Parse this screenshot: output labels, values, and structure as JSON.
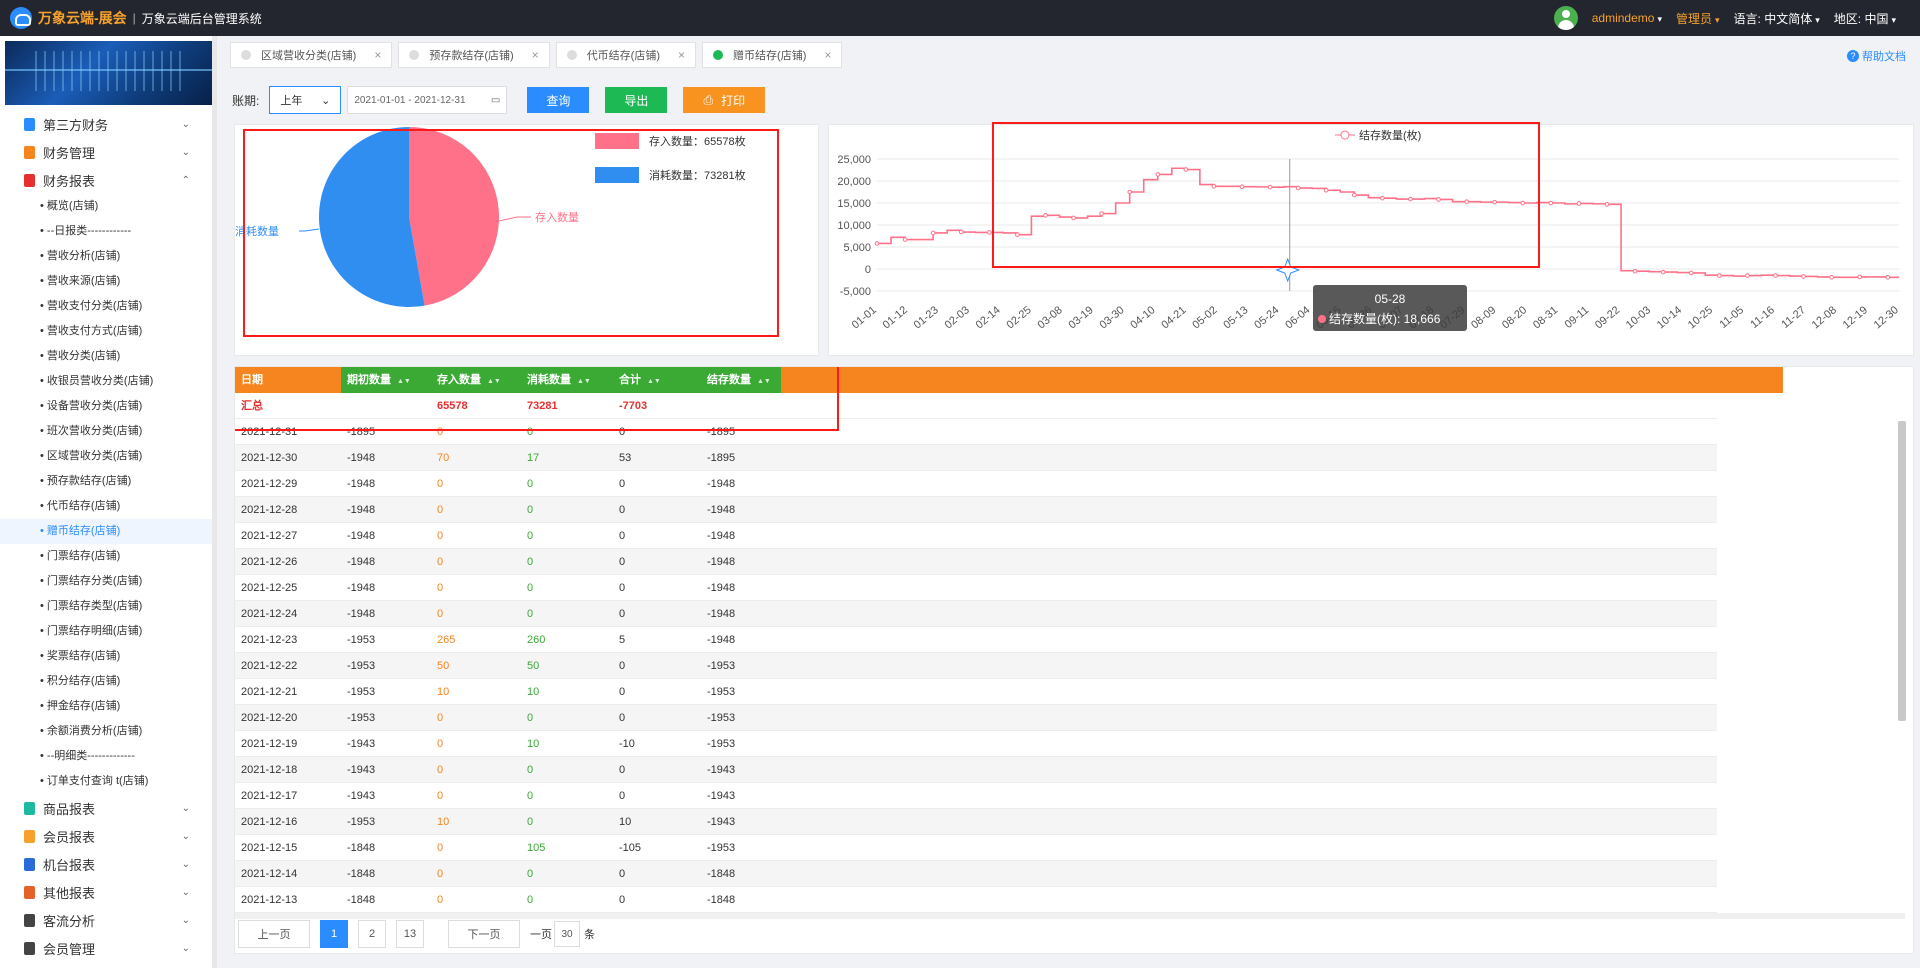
{
  "topbar": {
    "brand": "万象云端-展会",
    "separator": "|",
    "system": "万象云端后台管理系统",
    "user": "admindemo",
    "role": "管理员",
    "lang_label": "语言:",
    "lang_value": "中文简体",
    "region_label": "地区:",
    "region_value": "中国"
  },
  "sidebar": {
    "groups_top": [
      {
        "label": "第三方财务",
        "color": "#2a8cff",
        "chev": "⌄"
      },
      {
        "label": "财务管理",
        "color": "#f6841f",
        "chev": "⌄"
      },
      {
        "label": "财务报表",
        "color": "#e62f2f",
        "chev": "⌃"
      }
    ],
    "items": [
      "概览(店铺)",
      "--日报类------------",
      "营收分析(店铺)",
      "营收来源(店铺)",
      "营收支付分类(店铺)",
      "营收支付方式(店铺)",
      "营收分类(店铺)",
      "收银员营收分类(店铺)",
      "设备营收分类(店铺)",
      "班次营收分类(店铺)",
      "区域营收分类(店铺)",
      "预存款结存(店铺)",
      "代币结存(店铺)",
      "赠币结存(店铺)",
      "门票结存(店铺)",
      "门票结存分类(店铺)",
      "门票结存类型(店铺)",
      "门票结存明细(店铺)",
      "奖票结存(店铺)",
      "积分结存(店铺)",
      "押金结存(店铺)",
      "余额消费分析(店铺)",
      "--明细类-------------",
      "订单支付查询 t(店铺)"
    ],
    "active_index": 13,
    "groups_bottom": [
      {
        "label": "商品报表",
        "color": "#1db9a0",
        "chev": "⌄"
      },
      {
        "label": "会员报表",
        "color": "#f7a12d",
        "chev": "⌄"
      },
      {
        "label": "机台报表",
        "color": "#2a6bd8",
        "chev": "⌄"
      },
      {
        "label": "其他报表",
        "color": "#e2622a",
        "chev": "⌄"
      },
      {
        "label": "客流分析",
        "color": "#444444",
        "chev": "⌄"
      },
      {
        "label": "会员管理",
        "color": "#444444",
        "chev": "⌄"
      }
    ]
  },
  "tabs": [
    {
      "label": "区域营收分类(店铺)",
      "active": false
    },
    {
      "label": "预存款结存(店铺)",
      "active": false
    },
    {
      "label": "代币结存(店铺)",
      "active": false
    },
    {
      "label": "赠币结存(店铺)",
      "active": true
    }
  ],
  "tab_close": "×",
  "help": {
    "label": "帮助文档",
    "icon": "?"
  },
  "filter": {
    "label": "账期:",
    "period": "上年",
    "date_range": "2021-01-01 - 2021-12-31",
    "query": "查询",
    "export": "导出",
    "print": "打印",
    "print_icon": "⎙"
  },
  "pie": {
    "legend": [
      {
        "label": "存入数量：65578枚",
        "color": "#ff7189"
      },
      {
        "label": "消耗数量：73281枚",
        "color": "#2f8ef0"
      }
    ],
    "label_in": "存入数量",
    "label_out": "消耗数量",
    "values": {
      "in": 65578,
      "out": 73281
    }
  },
  "chart_data": {
    "type": "line",
    "legend": "结存数量(枚)",
    "color": "#ff7189",
    "yticks": [
      "25,000",
      "20,000",
      "15,000",
      "10,000",
      "5,000",
      "0",
      "-5,000"
    ],
    "ylim": [
      -5000,
      25000
    ],
    "xticks": [
      "01-01",
      "01-12",
      "01-23",
      "02-03",
      "02-14",
      "02-25",
      "03-08",
      "03-19",
      "03-30",
      "04-10",
      "04-21",
      "05-02",
      "05-13",
      "05-24",
      "06-04",
      "06-15",
      "06-26",
      "07-07",
      "07-18",
      "07-29",
      "08-09",
      "08-20",
      "08-31",
      "09-11",
      "09-22",
      "10-03",
      "10-14",
      "10-25",
      "11-05",
      "11-16",
      "11-27",
      "12-08",
      "12-19",
      "12-30"
    ],
    "x": [
      0,
      5,
      10,
      15,
      20,
      25,
      30,
      35,
      40,
      45,
      50,
      55,
      60,
      65,
      70,
      75,
      80,
      85,
      90,
      95,
      100,
      105,
      110,
      115,
      120,
      125,
      130,
      135,
      140,
      145,
      150,
      155,
      160,
      165,
      170,
      175,
      180,
      185,
      190,
      195,
      200,
      205,
      210,
      215,
      220,
      225,
      230,
      235,
      240,
      245,
      250,
      255,
      260,
      265,
      270,
      275,
      280,
      285,
      290,
      295,
      300,
      305,
      310,
      315,
      320,
      325,
      330,
      335,
      340,
      345,
      350,
      355,
      360,
      364
    ],
    "y": [
      5800,
      7200,
      6700,
      6700,
      8200,
      8800,
      8400,
      8300,
      8300,
      8200,
      7800,
      12000,
      12200,
      11800,
      11600,
      12000,
      12600,
      15000,
      17500,
      20300,
      21500,
      22900,
      22600,
      19200,
      18800,
      18800,
      18700,
      18666,
      18600,
      18700,
      18400,
      18300,
      17900,
      17500,
      16800,
      16200,
      16100,
      15900,
      15900,
      16000,
      15800,
      15300,
      15300,
      15200,
      15200,
      15100,
      15000,
      15100,
      15000,
      14800,
      14900,
      14800,
      14700,
      -400,
      -500,
      -600,
      -700,
      -800,
      -900,
      -1400,
      -1500,
      -1600,
      -1500,
      -1400,
      -1500,
      -1600,
      -1700,
      -1800,
      -1900,
      -1900,
      -1800,
      -1800,
      -1900,
      -1900
    ],
    "tooltip": {
      "date": "05-28",
      "label": "结存数量(枚): 18,666"
    }
  },
  "table": {
    "headers": [
      "日期",
      "期初数量",
      "存入数量",
      "消耗数量",
      "合计",
      "结存数量"
    ],
    "sort_icon": "▲▼",
    "summary": [
      "汇总",
      "",
      "65578",
      "73281",
      "-7703",
      ""
    ],
    "rows": [
      [
        "2021-12-31",
        "-1895",
        "0",
        "0",
        "0",
        "-1895"
      ],
      [
        "2021-12-30",
        "-1948",
        "70",
        "17",
        "53",
        "-1895"
      ],
      [
        "2021-12-29",
        "-1948",
        "0",
        "0",
        "0",
        "-1948"
      ],
      [
        "2021-12-28",
        "-1948",
        "0",
        "0",
        "0",
        "-1948"
      ],
      [
        "2021-12-27",
        "-1948",
        "0",
        "0",
        "0",
        "-1948"
      ],
      [
        "2021-12-26",
        "-1948",
        "0",
        "0",
        "0",
        "-1948"
      ],
      [
        "2021-12-25",
        "-1948",
        "0",
        "0",
        "0",
        "-1948"
      ],
      [
        "2021-12-24",
        "-1948",
        "0",
        "0",
        "0",
        "-1948"
      ],
      [
        "2021-12-23",
        "-1953",
        "265",
        "260",
        "5",
        "-1948"
      ],
      [
        "2021-12-22",
        "-1953",
        "50",
        "50",
        "0",
        "-1953"
      ],
      [
        "2021-12-21",
        "-1953",
        "10",
        "10",
        "0",
        "-1953"
      ],
      [
        "2021-12-20",
        "-1953",
        "0",
        "0",
        "0",
        "-1953"
      ],
      [
        "2021-12-19",
        "-1943",
        "0",
        "10",
        "-10",
        "-1953"
      ],
      [
        "2021-12-18",
        "-1943",
        "0",
        "0",
        "0",
        "-1943"
      ],
      [
        "2021-12-17",
        "-1943",
        "0",
        "0",
        "0",
        "-1943"
      ],
      [
        "2021-12-16",
        "-1953",
        "10",
        "0",
        "10",
        "-1943"
      ],
      [
        "2021-12-15",
        "-1848",
        "0",
        "105",
        "-105",
        "-1953"
      ],
      [
        "2021-12-14",
        "-1848",
        "0",
        "0",
        "0",
        "-1848"
      ],
      [
        "2021-12-13",
        "-1848",
        "0",
        "0",
        "0",
        "-1848"
      ]
    ]
  },
  "pager": {
    "prev": "上一页",
    "pages": [
      "1",
      "2",
      "13"
    ],
    "current": "1",
    "next": "下一页",
    "per_page_prefix": "一页",
    "per_page": "30",
    "per_page_suffix": "条"
  }
}
